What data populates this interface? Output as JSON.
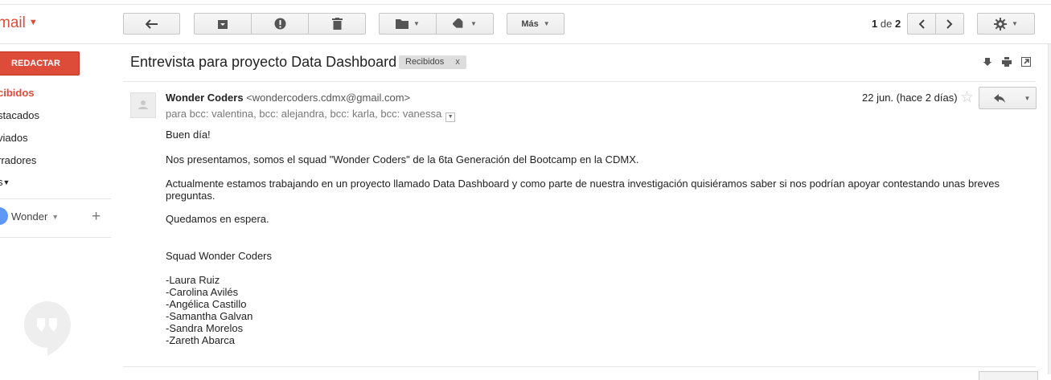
{
  "app": {
    "logo_text": "mail"
  },
  "sidebar": {
    "compose_label": "REDACTAR",
    "items": [
      {
        "label": "cibidos",
        "active": true
      },
      {
        "label": "stacados"
      },
      {
        "label": "viados"
      },
      {
        "label": "rradores"
      },
      {
        "label": "s"
      }
    ],
    "hangouts_user": "Wonder"
  },
  "toolbar": {
    "more_label": "Más",
    "page_count": "1",
    "page_of": "de",
    "page_total": "2"
  },
  "thread": {
    "subject": "Entrevista para proyecto Data Dashboard",
    "label": "Recibidos",
    "label_remove": "x"
  },
  "message": {
    "sender_name": "Wonder Coders",
    "sender_email": "<wondercoders.cdmx@gmail.com>",
    "recipients": "para bcc: valentina, bcc: alejandra, bcc: karla, bcc: vanessa",
    "date": "22 jun. (hace 2 días)",
    "body": {
      "greeting": "Buen día!",
      "p1": "Nos presentamos, somos el squad \"Wonder Coders\" de la 6ta Generación del Bootcamp en la CDMX.",
      "p2": "Actualmente estamos trabajando en un proyecto llamado Data Dashboard y como parte de nuestra investigación quisiéramos saber si nos podrían apoyar contestando unas breves preguntas.",
      "p3": "Quedamos en espera.",
      "signature": "Squad Wonder Coders",
      "members": [
        "-Laura Ruiz",
        "-Carolina Avilés",
        "-Angélica Castillo",
        "-Samantha Galvan",
        "-Sandra Morelos",
        "-Zareth Abarca"
      ]
    }
  },
  "colors": {
    "accent": "#dd4b39",
    "avatar_blue": "#5e97f6"
  }
}
